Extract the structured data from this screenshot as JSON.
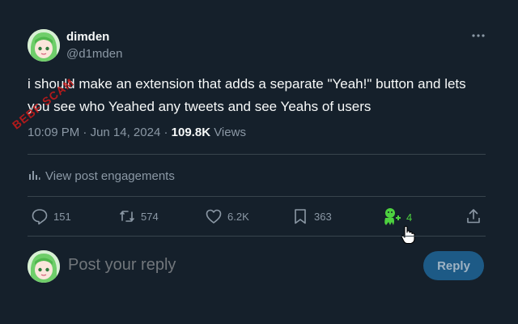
{
  "post": {
    "author_name": "dimden",
    "author_handle": "@d1mden",
    "text": "i should make an extension that adds a separate \"Yeah!\" button and lets you see who Yeahed any tweets and see Yeahs of users",
    "time": "10:09 PM",
    "separator": "·",
    "date": "Jun 14, 2024",
    "views_count": "109.8K",
    "views_label": "Views",
    "stamp_text": "BEBF SCAM"
  },
  "engagements_label": "View post engagements",
  "actions": {
    "replies": "151",
    "reposts": "574",
    "likes": "6.2K",
    "bookmarks": "363",
    "yeahs": "4"
  },
  "reply": {
    "placeholder": "Post your reply",
    "button_label": "Reply"
  },
  "colors": {
    "background": "#15202b",
    "muted": "#8b98a5",
    "divider": "#38444d",
    "yeah_green": "#4dd13f",
    "reply_button": "#1d5a86"
  },
  "icons": [
    "more-icon",
    "analytics-icon",
    "reply-icon",
    "repost-icon",
    "like-icon",
    "bookmark-icon",
    "yeah-icon",
    "share-icon",
    "cursor-icon"
  ]
}
